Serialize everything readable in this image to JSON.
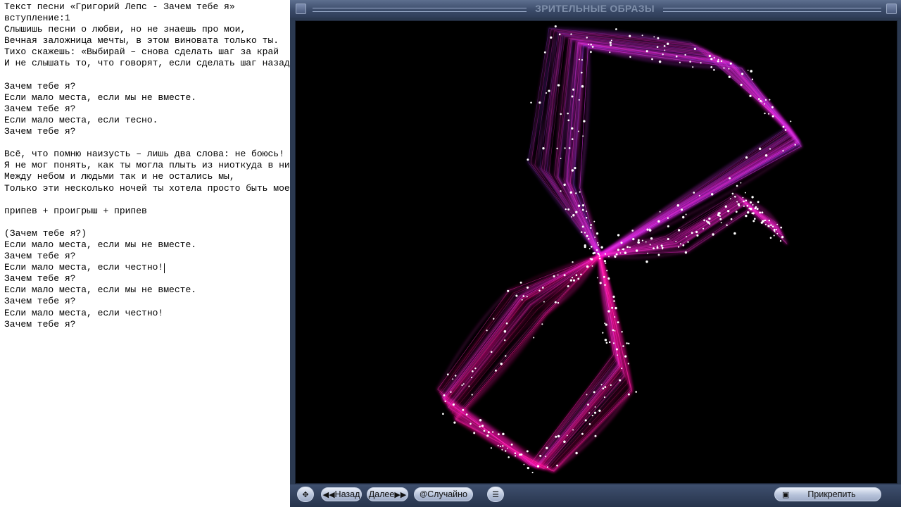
{
  "editor": {
    "lines": [
      "Текст песни «Григорий Лепс - Зачем тебе я»",
      "вступление:1",
      "Слышишь песни о любви, но не знаешь про мои,",
      "Вечная заложница мечты, в этом виновата только ты.",
      "Тихо скажешь: «Выбирай – снова сделать шаг за край",
      "И не слышать то, что говорят, если сделать шаг назад».",
      "",
      "Зачем тебе я?",
      "Если мало места, если мы не вместе.",
      "Зачем тебе я?",
      "Если мало места, если тесно.",
      "Зачем тебе я?",
      "",
      "Всё, что помню наизусть – лишь два слова: не боюсь!",
      "Я не мог понять, как ты могла плыть из ниоткуда в никуда.",
      "Между небом и людьми так и не остались мы,",
      "Только эти несколько ночей ты хотела просто быть моей!",
      "",
      "припев + проигрыш + припев",
      "",
      "(Зачем тебе я?)",
      "Если мало места, если мы не вместе.",
      "Зачем тебе я?",
      "Если мало места, если честно!",
      "Зачем тебе я?",
      "Если мало места, если мы не вместе.",
      "Зачем тебе я?",
      "Если мало места, если честно!",
      "Зачем тебе я?"
    ]
  },
  "player": {
    "title": "ЗРИТЕЛЬНЫЕ ОБРАЗЫ",
    "controls": {
      "back_label": "Назад",
      "next_label": "Далее",
      "random_label": "Случайно",
      "pin_label": "Прикрепить"
    },
    "icons": {
      "move": "move-arrows-icon",
      "back": "double-left-arrow-icon",
      "next": "double-right-arrow-icon",
      "random": "at-sign-icon",
      "menu": "list-menu-icon",
      "pin": "pin-window-icon"
    },
    "visualization": {
      "colors": {
        "background": "#000000",
        "magenta": "#ff2bd6",
        "pink": "#ff1f8a",
        "violet": "#9a3cf0",
        "dots": "#ffffff"
      }
    }
  }
}
